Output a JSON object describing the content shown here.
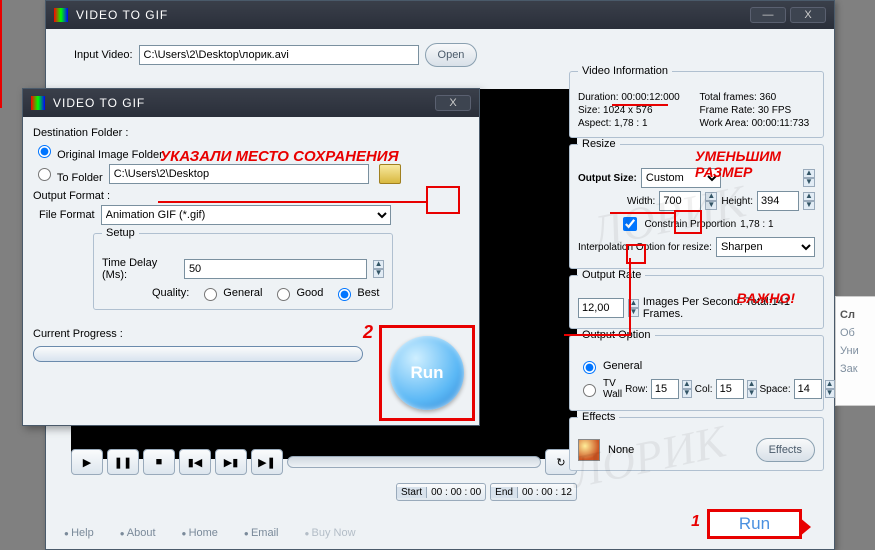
{
  "main_title": "VIDEO TO GIF",
  "input": {
    "label": "Input Video:",
    "path": "C:\\Users\\2\\Desktop\\лорик.avi",
    "open": "Open"
  },
  "info": {
    "title": "Video Information",
    "duration_l": "Duration:",
    "duration_v": "00:00:12:000",
    "size_l": "Size:",
    "size_v": "1024 x 576",
    "aspect_l": "Aspect:",
    "aspect_v": "1,78 : 1",
    "tf_l": "Total frames:",
    "tf_v": "360",
    "fr_l": "Frame Rate:",
    "fr_v": "30 FPS",
    "wa_l": "Work Area:",
    "wa_v": "00:00:11:733"
  },
  "resize": {
    "title": "Resize",
    "outsize_l": "Output Size:",
    "outsize_v": "Custom",
    "w_l": "Width:",
    "w_v": "700",
    "h_l": "Height:",
    "h_v": "394",
    "cp_l": "Constrain Proportion",
    "cp_v": "1,78 : 1",
    "interp_l": "Interpolation Option for resize:",
    "interp_v": "Sharpen"
  },
  "rate": {
    "title": "Output Rate",
    "v": "12,00",
    "suffix": "Images Per Second. Total:141 Frames."
  },
  "oopt": {
    "title": "Output Option",
    "general": "General",
    "tvwall": "TV Wall",
    "row_l": "Row:",
    "row_v": "15",
    "col_l": "Col:",
    "col_v": "15",
    "space_l": "Space:",
    "space_v": "14"
  },
  "effects": {
    "title": "Effects",
    "none": "None",
    "btn": "Effects"
  },
  "player": {
    "start_l": "Start",
    "start_v": "00 : 00 : 00",
    "end_l": "End",
    "end_v": "00 : 00 : 12"
  },
  "links": {
    "help": "Help",
    "about": "About",
    "home": "Home",
    "email": "Email",
    "buy": "Buy Now"
  },
  "run_main": "Run",
  "one": "1",
  "dlg": {
    "title": "VIDEO TO GIF",
    "dest_l": "Destination Folder :",
    "orig": "Original Image Folder",
    "to_l": "To Folder",
    "to_v": "C:\\Users\\2\\Desktop",
    "fmt_title": "Output Format :",
    "fmt_l": "File Format",
    "fmt_v": "Animation GIF (*.gif)",
    "setup": "Setup",
    "td_l": "Time Delay (Ms): ",
    "td_v": "50",
    "q_l": "Quality:",
    "q1": "General",
    "q2": "Good",
    "q3": "Best",
    "prog_l": "Current Progress :",
    "run": "Run",
    "two": "2"
  },
  "ann": {
    "a1": "УКАЗАЛИ МЕСТО СОХРАНЕНИЯ",
    "a2": "УМЕНЬШИМ РАЗМЕР",
    "a3": "ВАЖНО!"
  },
  "wm": "ЛОРИК",
  "side": {
    "sl": "Сл",
    "ob": "Об",
    "un": "Уни",
    "za": "Зак"
  }
}
